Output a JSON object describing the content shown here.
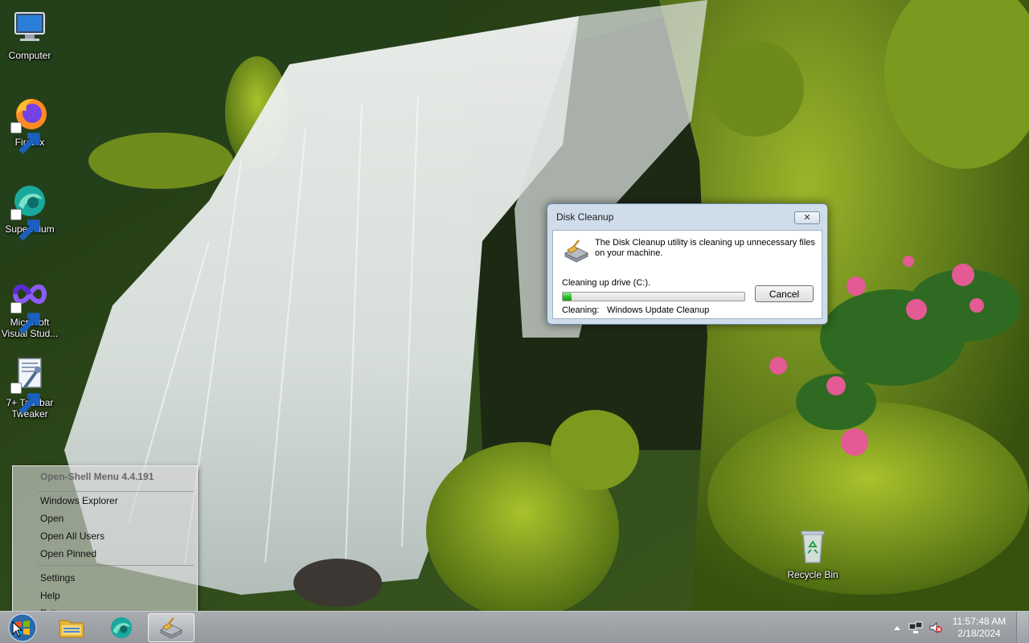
{
  "desktop": {
    "icons": [
      {
        "label_line1": "Computer",
        "label_line2": ""
      },
      {
        "label_line1": "Firefox",
        "label_line2": ""
      },
      {
        "label_line1": "Supermium",
        "label_line2": ""
      },
      {
        "label_line1": "Microsoft",
        "label_line2": "Visual Stud..."
      },
      {
        "label_line1": "7+ Taskbar",
        "label_line2": "Tweaker"
      },
      {
        "label_line1": "Recycle Bin",
        "label_line2": ""
      }
    ]
  },
  "dialog": {
    "title": "Disk Cleanup",
    "close_label": "✕",
    "message": "The Disk Cleanup utility is cleaning up unnecessary files on your machine.",
    "drive_label": "Cleaning up drive  (C:).",
    "progress_fraction": 0.05,
    "cleaning_label": "Cleaning:",
    "cleaning_item": "Windows Update Cleanup",
    "cancel_label": "Cancel"
  },
  "context_menu": {
    "header": "Open-Shell Menu 4.4.191",
    "items": [
      "Windows Explorer",
      "Open",
      "Open All Users",
      "Open Pinned",
      "Settings",
      "Help",
      "Exit"
    ]
  },
  "taskbar": {
    "pinned": [
      "file-explorer-icon",
      "supermium-icon",
      "disk-cleanup-icon"
    ],
    "clock_time": "11:57:48 AM",
    "clock_date": "2/18/2024"
  },
  "colors": {
    "progress_green": "#2bbd2b",
    "dialog_frame": "#cfdcea",
    "taskbar": "#a0a4a9"
  }
}
